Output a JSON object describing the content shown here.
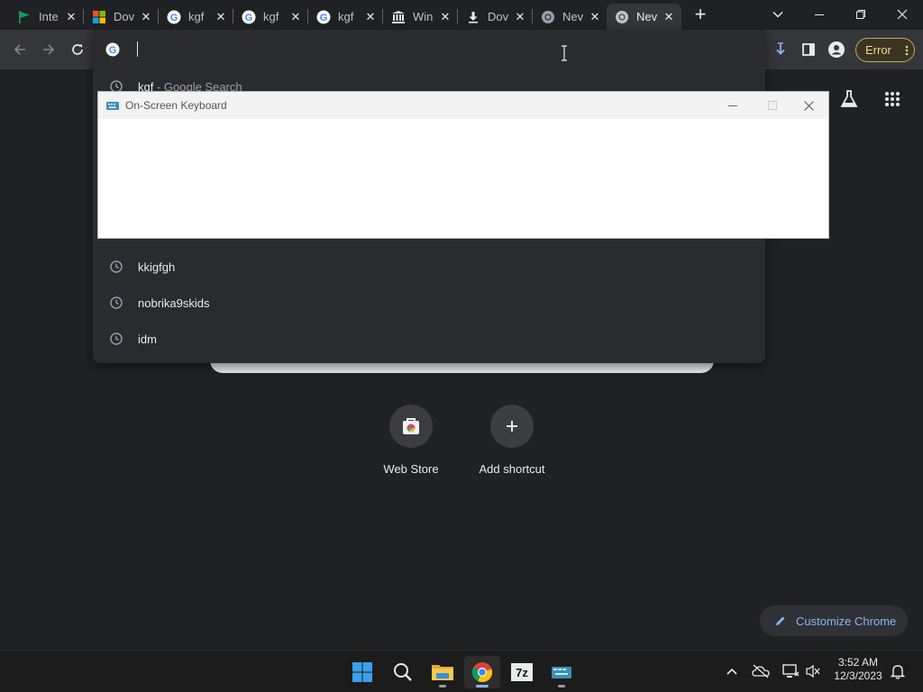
{
  "tabs": [
    {
      "title": "Inte",
      "icon": "flag-icon"
    },
    {
      "title": "Dov",
      "icon": "windows-logo-icon"
    },
    {
      "title": "kgf",
      "icon": "google-icon"
    },
    {
      "title": "kgf",
      "icon": "google-icon"
    },
    {
      "title": "kgf",
      "icon": "google-icon"
    },
    {
      "title": "Win",
      "icon": "museum-icon"
    },
    {
      "title": "Dov",
      "icon": "download-icon"
    },
    {
      "title": "Nev",
      "icon": "chrome-icon"
    },
    {
      "title": "Nev",
      "icon": "chrome-icon",
      "active": true
    }
  ],
  "tab_close_glyph": "✕",
  "new_tab_glyph": "+",
  "toolbar": {
    "error_label": "Error"
  },
  "omnibox": {
    "input_value": "",
    "suggestions": [
      {
        "text": "kgf",
        "subtext": " - Google Search",
        "icon": "history-icon"
      },
      {
        "text": "kkigfgh",
        "subtext": "",
        "icon": "history-icon"
      },
      {
        "text": "nobrika9skids",
        "subtext": "",
        "icon": "history-icon"
      },
      {
        "text": "idm",
        "subtext": "",
        "icon": "history-icon"
      }
    ]
  },
  "osk": {
    "title": "On-Screen Keyboard"
  },
  "ntp": {
    "shortcuts": [
      {
        "label": "Web Store",
        "icon": "web-store-icon"
      },
      {
        "label": "Add shortcut",
        "icon": "plus-icon"
      }
    ],
    "customize_label": "Customize Chrome"
  },
  "taskbar": {
    "time": "3:52 AM",
    "date": "12/3/2023"
  },
  "colors": {
    "background": "#202124",
    "toolbar": "#35363a",
    "link_blue": "#8ab4f8",
    "error_yellow": "#f5d88a"
  }
}
